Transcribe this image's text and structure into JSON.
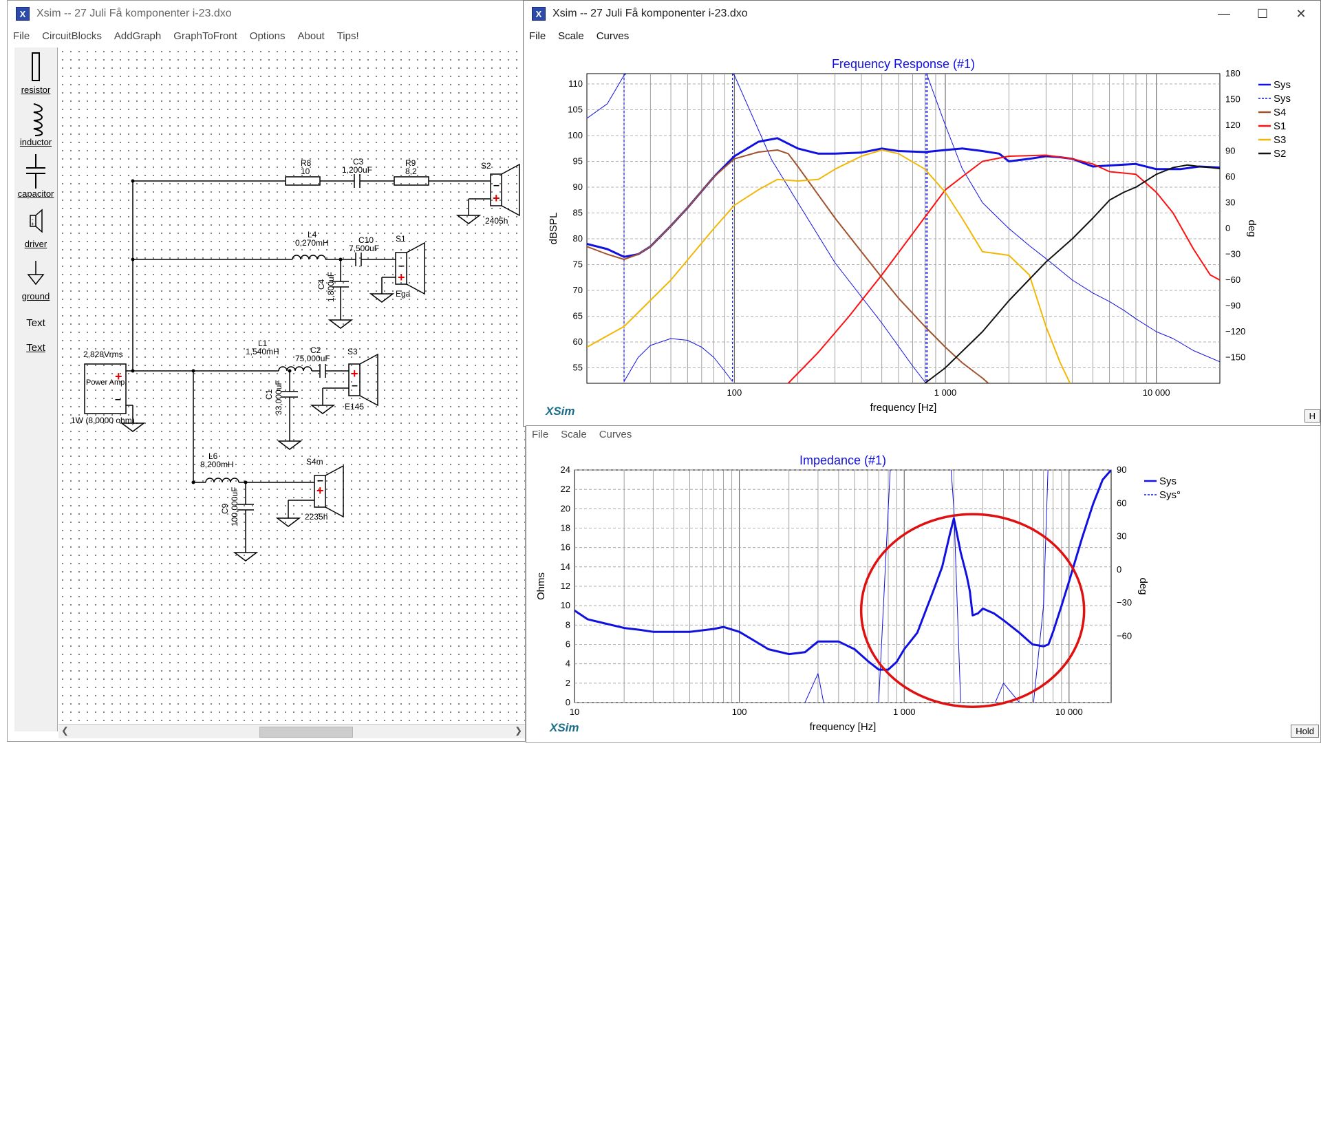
{
  "circuit_window": {
    "title": "Xsim -- 27 Juli Få komponenter i-23.dxo",
    "menu": [
      "File",
      "CircuitBlocks",
      "AddGraph",
      "GraphToFront",
      "Options",
      "About",
      "Tips!"
    ],
    "palette": [
      {
        "label": "resistor",
        "icon": "resistor-icon"
      },
      {
        "label": "inductor",
        "icon": "inductor-icon"
      },
      {
        "label": "capacitor",
        "icon": "capacitor-icon"
      },
      {
        "label": "driver",
        "icon": "driver-icon"
      },
      {
        "label": "ground",
        "icon": "ground-icon"
      },
      {
        "label": "Text",
        "icon": "text-icon"
      },
      {
        "label": "Text",
        "icon": "text-link"
      }
    ],
    "components": {
      "r8_name": "R8",
      "r8_value": "10",
      "c3_name": "C3",
      "c3_value": "1,200uF",
      "r9_name": "R9",
      "r9_value": "8,2",
      "s2_name": "S2",
      "s2_model": "2405h",
      "l4_name": "L4",
      "l4_value": "0,270mH",
      "c10_name": "C10",
      "c10_value": "7,500uF",
      "s1_name": "S1",
      "s1_model": "Ega",
      "c4_name": "C4",
      "c4_value": "1,800uF",
      "source_voltage": "2,828Vrms",
      "source_name": "Power Amp.",
      "source_note": "1W (8,0000 ohm)",
      "l1_name": "L1",
      "l1_value": "1,540mH",
      "c2_name": "C2",
      "c2_value": "75,000uF",
      "s3_name": "S3",
      "s3_model": "E145",
      "c1_name": "C1",
      "c1_value": "33,000uF",
      "l6_name": "L6",
      "l6_value": "8,200mH",
      "s4_name": "S4m",
      "s4_model": "2235h",
      "c9_name": "C9",
      "c9_value": "100,000uF"
    }
  },
  "freq_window": {
    "title": "Xsim -- 27 Juli Få komponenter i-23.dxo",
    "menu": [
      "File",
      "Scale",
      "Curves"
    ],
    "brand": "XSim",
    "hold_label": "H"
  },
  "imp_window": {
    "menu": [
      "File",
      "Scale",
      "Curves"
    ],
    "brand": "XSim",
    "hold_label": "Hold"
  },
  "chart_data": [
    {
      "type": "line",
      "title": "Frequency Response (#1)",
      "xlabel": "frequency [Hz]",
      "ylabel": "dBSPL",
      "y2label": "deg",
      "xscale": "log",
      "xlim": [
        20,
        20000
      ],
      "ylim": [
        52,
        112
      ],
      "y2lim": [
        -180,
        180
      ],
      "xticks": [
        100,
        1000,
        10000
      ],
      "xtick_labels": [
        "100",
        "1 000",
        "10 000"
      ],
      "yticks": [
        55,
        60,
        65,
        70,
        75,
        80,
        85,
        90,
        95,
        100,
        105,
        110
      ],
      "y2ticks": [
        -150,
        -120,
        -90,
        -60,
        -30,
        0,
        30,
        60,
        90,
        120,
        150,
        180
      ],
      "grid": true,
      "legend": "right",
      "markers_hz": [
        30,
        98,
        810,
        820
      ],
      "series": [
        {
          "name": "Sys",
          "color": "#1010e0",
          "width": 3,
          "dash": false,
          "x": [
            20,
            25,
            30,
            35,
            40,
            50,
            60,
            80,
            100,
            130,
            160,
            200,
            250,
            300,
            400,
            500,
            600,
            800,
            1000,
            1200,
            1500,
            1800,
            2000,
            2500,
            3000,
            3500,
            4000,
            5000,
            6000,
            8000,
            10000,
            13000,
            16000,
            20000
          ],
          "y": [
            79,
            78,
            76.5,
            77,
            78.5,
            82.5,
            86,
            92,
            96,
            98.8,
            99.5,
            97.5,
            96.5,
            96.5,
            96.7,
            97.5,
            97,
            96.8,
            97.2,
            97.5,
            97,
            96.5,
            95,
            95.5,
            96,
            95.8,
            95.5,
            94,
            94.2,
            94.5,
            93.5,
            93.5,
            94,
            93.8
          ]
        },
        {
          "name": "Sys",
          "color": "#1010e0",
          "width": 1,
          "dash": false,
          "axis": "y2",
          "x": [
            20,
            25,
            30,
            40,
            60,
            80,
            100,
            150,
            200,
            300,
            500,
            700,
            810
          ],
          "y": [
            128,
            145,
            178,
            200,
            200,
            200,
            178,
            80,
            30,
            -40,
            -110,
            -160,
            -180
          ]
        },
        {
          "name": "",
          "color": "#1010e0",
          "width": 1,
          "dash": false,
          "axis": "y2",
          "x": [
            820,
            1000,
            1200,
            1500,
            2000,
            2500,
            3000,
            4000,
            5000,
            6000,
            7000,
            8000,
            10000,
            12000,
            15000,
            20000
          ],
          "y": [
            178,
            120,
            70,
            30,
            0,
            -20,
            -35,
            -60,
            -75,
            -85,
            -95,
            -105,
            -120,
            -128,
            -142,
            -155
          ]
        },
        {
          "name": "",
          "color": "#1010e0",
          "width": 1,
          "dash": false,
          "axis": "y2",
          "x": [
            30,
            35,
            40,
            50,
            60,
            70,
            80,
            90,
            98
          ],
          "y": [
            -178,
            -150,
            -136,
            -128,
            -130,
            -138,
            -150,
            -166,
            -178
          ]
        },
        {
          "name": "S4",
          "color": "#a0522d",
          "width": 2,
          "dash": false,
          "x": [
            20,
            25,
            30,
            35,
            40,
            50,
            60,
            80,
            100,
            130,
            160,
            180,
            200,
            250,
            300,
            400,
            500,
            600,
            800,
            1000,
            1200,
            1500,
            1600
          ],
          "y": [
            78.5,
            77,
            76,
            77,
            78.5,
            82.5,
            86,
            92,
            95.5,
            96.8,
            97.2,
            96.5,
            94,
            88.5,
            84,
            77.5,
            72.5,
            68.5,
            63,
            59,
            56,
            53,
            52
          ]
        },
        {
          "name": "S1",
          "color": "#ff1010",
          "width": 2,
          "dash": false,
          "x": [
            180,
            250,
            350,
            500,
            700,
            900,
            1000,
            1200,
            1500,
            2000,
            3000,
            4000,
            5000,
            6000,
            8000,
            10000,
            12000,
            15000,
            18000,
            20000
          ],
          "y": [
            52,
            58,
            65,
            73,
            81,
            87,
            89.5,
            92,
            95,
            96,
            96.2,
            95.5,
            94.5,
            93,
            92.5,
            89,
            85,
            78,
            73,
            72
          ]
        },
        {
          "name": "S3",
          "color": "#f2b705",
          "width": 2,
          "dash": false,
          "x": [
            20,
            30,
            50,
            80,
            100,
            130,
            160,
            200,
            250,
            300,
            400,
            500,
            600,
            800,
            1000,
            1200,
            1500,
            2000,
            2500,
            3000,
            3500,
            3900
          ],
          "y": [
            59,
            63,
            72,
            82,
            86.5,
            89.5,
            91.5,
            91.2,
            91.5,
            93.5,
            96,
            97.2,
            96.5,
            93.5,
            89,
            84,
            77.5,
            76.8,
            73,
            63,
            56,
            52
          ]
        },
        {
          "name": "S2",
          "color": "#111111",
          "width": 2,
          "dash": false,
          "x": [
            800,
            1000,
            1500,
            2000,
            3000,
            4000,
            5000,
            6000,
            7000,
            8000,
            10000,
            12000,
            14000,
            16000,
            18000,
            20000
          ],
          "y": [
            52,
            55,
            62,
            68,
            75.5,
            80,
            84,
            87.5,
            89,
            90,
            92.5,
            93.8,
            94.3,
            94,
            93.8,
            93.6
          ]
        }
      ],
      "legend_entries": [
        {
          "name": "Sys",
          "color": "#1010e0",
          "dash": false
        },
        {
          "name": "Sys",
          "color": "#1010e0",
          "dash": true
        },
        {
          "name": "S4",
          "color": "#a0522d",
          "dash": false
        },
        {
          "name": "S1",
          "color": "#ff1010",
          "dash": false
        },
        {
          "name": "S3",
          "color": "#f2b705",
          "dash": false
        },
        {
          "name": "S2",
          "color": "#111111",
          "dash": false
        }
      ]
    },
    {
      "type": "line",
      "title": "Impedance (#1)",
      "xlabel": "frequency [Hz]",
      "ylabel": "Ohms",
      "y2label": "deg",
      "xscale": "log",
      "xlim": [
        10,
        18000
      ],
      "ylim": [
        0,
        24
      ],
      "y2lim": [
        -120,
        90
      ],
      "xticks": [
        10,
        100,
        1000,
        10000
      ],
      "xtick_labels": [
        "10",
        "100",
        "1 000",
        "10 000"
      ],
      "yticks": [
        0,
        2,
        4,
        6,
        8,
        10,
        12,
        14,
        16,
        18,
        20,
        22,
        24
      ],
      "y2ticks": [
        -60,
        -30,
        0,
        30,
        60,
        90
      ],
      "grid": true,
      "legend": "right",
      "annotation": {
        "type": "ellipse",
        "color": "#e01010",
        "center_hz": 2600,
        "center_ohm": 9.5
      },
      "series": [
        {
          "name": "Sys",
          "color": "#1010e0",
          "width": 3,
          "dash": false,
          "x": [
            10,
            12,
            15,
            20,
            25,
            30,
            40,
            50,
            70,
            80,
            100,
            120,
            150,
            200,
            250,
            300,
            400,
            500,
            600,
            700,
            800,
            900,
            1000,
            1200,
            1500,
            1700,
            1900,
            2000,
            2200,
            2400,
            2500,
            2600,
            2800,
            3000,
            3500,
            4000,
            5000,
            6000,
            7000,
            7500,
            8000,
            9000,
            10000,
            12000,
            14000,
            16000,
            18000
          ],
          "y": [
            9.5,
            8.6,
            8.2,
            7.7,
            7.5,
            7.3,
            7.3,
            7.3,
            7.6,
            7.8,
            7.3,
            6.5,
            5.5,
            5,
            5.2,
            6.3,
            6.3,
            5.5,
            4.3,
            3.4,
            3.4,
            4.2,
            5.5,
            7.2,
            11.5,
            14,
            17.5,
            19,
            15.5,
            13,
            11.5,
            9,
            9.2,
            9.7,
            9.2,
            8.5,
            7.2,
            6,
            5.8,
            6,
            7.3,
            10,
            12.5,
            17,
            20.5,
            23,
            24
          ]
        },
        {
          "name": "Sys°",
          "color": "#1010e0",
          "width": 1,
          "dash": false,
          "x": [
            10,
            15,
            20,
            30,
            40,
            50,
            70,
            100,
            150,
            200,
            250,
            300,
            400,
            500,
            700,
            800,
            1000,
            1200,
            1500,
            2000,
            2200,
            2500,
            3000,
            4000,
            5000,
            6000,
            7000,
            8000,
            10000,
            12000,
            15000,
            18000
          ],
          "y": [
            -45,
            -38,
            -32,
            -18,
            -15,
            -13,
            -12,
            -17,
            -20,
            -14,
            0,
            3,
            -8,
            -11,
            0,
            20,
            52,
            58,
            50,
            20,
            0,
            -10,
            -3,
            2,
            0,
            -1,
            10,
            40,
            60,
            58,
            50,
            40
          ]
        }
      ],
      "legend_entries": [
        {
          "name": "Sys",
          "color": "#1010e0",
          "dash": false
        },
        {
          "name": "Sys°",
          "color": "#1010e0",
          "dash": true
        }
      ]
    }
  ]
}
